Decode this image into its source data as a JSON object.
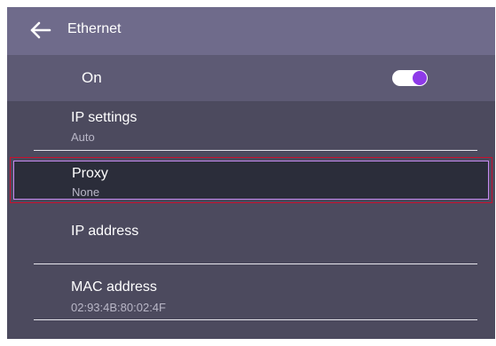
{
  "header": {
    "title": "Ethernet",
    "back_icon": "arrow-left-icon"
  },
  "toggle_row": {
    "label": "On",
    "state": "on",
    "accent_color": "#8e3ae8"
  },
  "settings": [
    {
      "title": "IP settings",
      "value": "Auto"
    },
    {
      "title": "Proxy",
      "value": "None",
      "selected": true
    },
    {
      "title": "IP address",
      "value": ""
    },
    {
      "title": "MAC address",
      "value": "02:93:4B:80:02:4F"
    }
  ],
  "colors": {
    "header_bg": "#6f6b8b",
    "panel_bg": "#4c4a5e",
    "selected_bg": "#2b2d3a",
    "selection_outline": "#c8102e"
  }
}
